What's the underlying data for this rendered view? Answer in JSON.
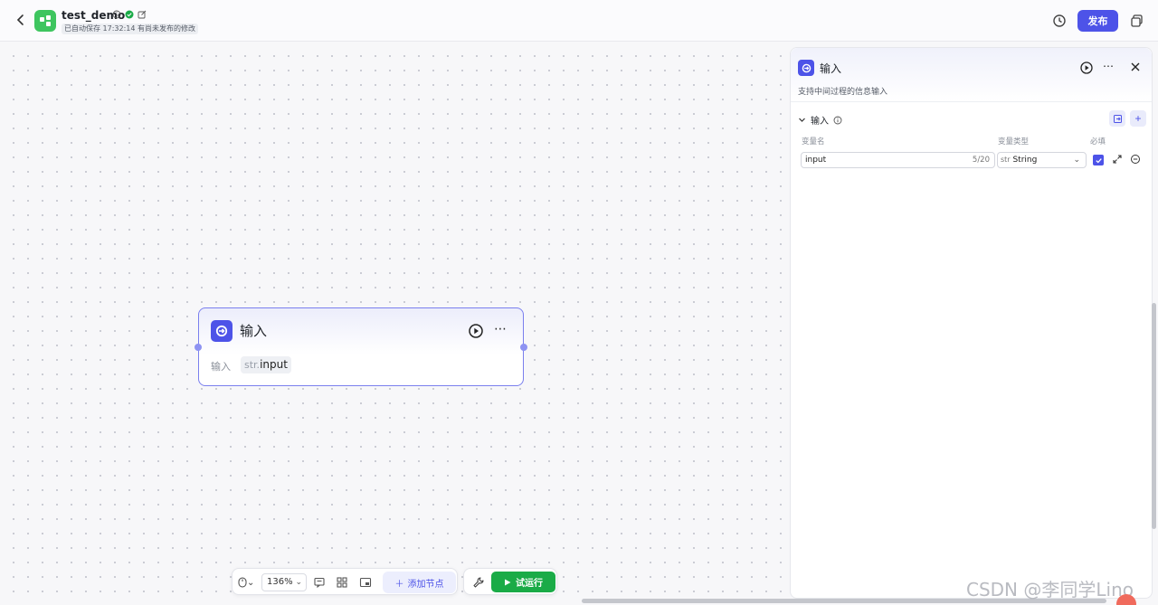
{
  "header": {
    "app_name": "test_demo",
    "saved_tag": "已自动保存 17:32:14",
    "unpublished_tag": "有尚未发布的修改",
    "publish_label": "发布",
    "colors": {
      "accent": "#4d53e8",
      "logo": "#3ec55f"
    }
  },
  "canvas": {
    "node": {
      "title": "输入",
      "field_label": "输入",
      "var_type_prefix": "str.",
      "var_name": "input"
    }
  },
  "toolbar": {
    "zoom": "136%",
    "add_node_label": "添加节点",
    "run_label": "试运行",
    "run_color": "#1aab47"
  },
  "panel": {
    "title": "输入",
    "description": "支持中间过程的信息输入",
    "section_title": "输入",
    "columns": {
      "name": "变量名",
      "type": "变量类型",
      "required": "必填"
    },
    "row": {
      "name": "input",
      "count": "5/20",
      "type_prefix": "str",
      "type": "String",
      "required": true
    }
  },
  "watermark": "CSDN @李同学Lino"
}
